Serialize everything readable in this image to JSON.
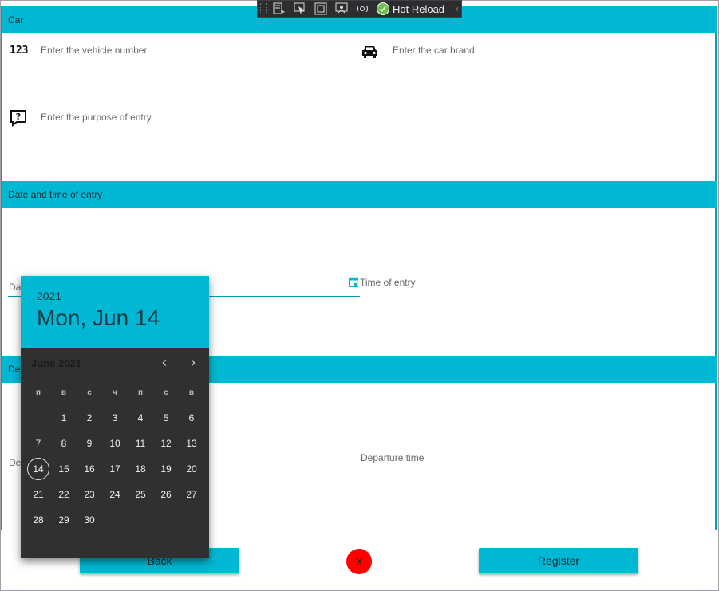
{
  "toolbar": {
    "hot_reload_label": "Hot Reload",
    "buttons": [
      "select-element-icon",
      "pointer-icon",
      "frame-icon",
      "track-focus-icon",
      "sync-icon"
    ]
  },
  "car_section": {
    "header": "Car",
    "vehicle_number_placeholder": "Enter the vehicle number",
    "vehicle_number_icon_text": "123",
    "car_brand_placeholder": "Enter the car brand",
    "purpose_placeholder": "Enter the purpose of entry",
    "purpose_icon_text": "?"
  },
  "entry_section": {
    "header": "Date and time of entry",
    "date_label_partial": "Da",
    "time_placeholder": "Time of entry"
  },
  "departure_section": {
    "header_partial": "De",
    "date_label_partial": "De",
    "time_placeholder": "Departure time"
  },
  "buttons": {
    "back": "Back",
    "register": "Register",
    "close": "X"
  },
  "date_picker": {
    "year": "2021",
    "selected_date": "Mon, Jun 14",
    "month_label": "June 2021",
    "prev": "‹",
    "next": "›",
    "weekdays": [
      "п",
      "в",
      "с",
      "ч",
      "п",
      "с",
      "в"
    ],
    "weeks": [
      [
        "",
        "1",
        "2",
        "3",
        "4",
        "5",
        "6"
      ],
      [
        "7",
        "8",
        "9",
        "10",
        "11",
        "12",
        "13"
      ],
      [
        "14",
        "15",
        "16",
        "17",
        "18",
        "19",
        "20"
      ],
      [
        "21",
        "22",
        "23",
        "24",
        "25",
        "26",
        "27"
      ],
      [
        "28",
        "29",
        "30",
        "",
        "",
        "",
        ""
      ]
    ],
    "selected_day": "14"
  },
  "colors": {
    "accent": "#00b8d4",
    "picker_bg": "#303030",
    "close_button": "#ff0000"
  }
}
